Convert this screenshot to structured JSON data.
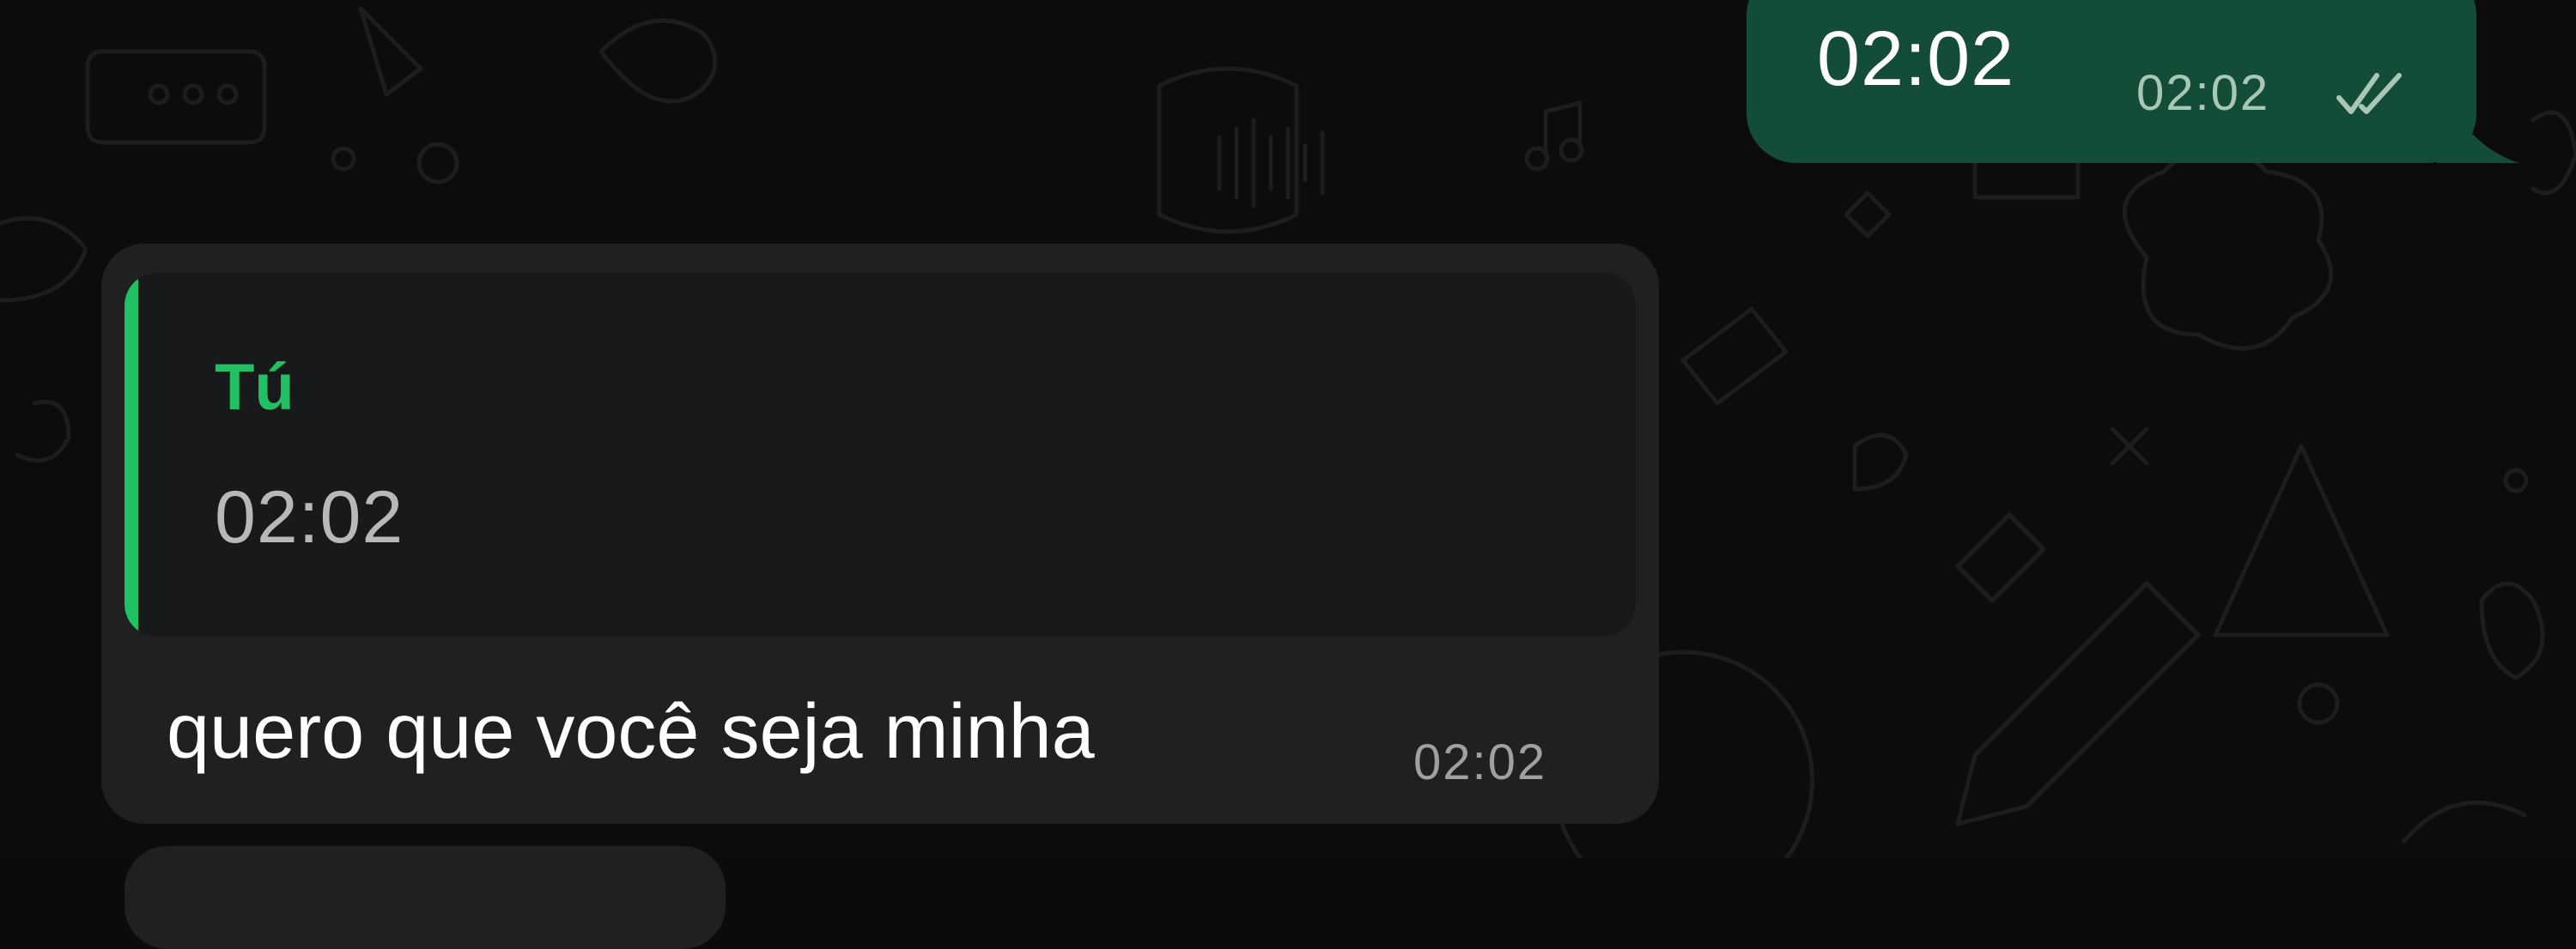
{
  "conversation": {
    "outgoing": {
      "text": "02:02",
      "time": "02:02",
      "status_icon": "double-check-read-icon"
    },
    "incoming": {
      "reply": {
        "author": "Tú",
        "text": "02:02"
      },
      "text": "quero que você seja minha",
      "time": "02:02"
    }
  },
  "colors": {
    "background": "#0c0c0c",
    "outgoing_bubble": "#144d37",
    "incoming_bubble": "#1f2022",
    "reply_accent": "#21c063",
    "primary_text": "#ffffff",
    "secondary_text": "#a0a0a0"
  }
}
